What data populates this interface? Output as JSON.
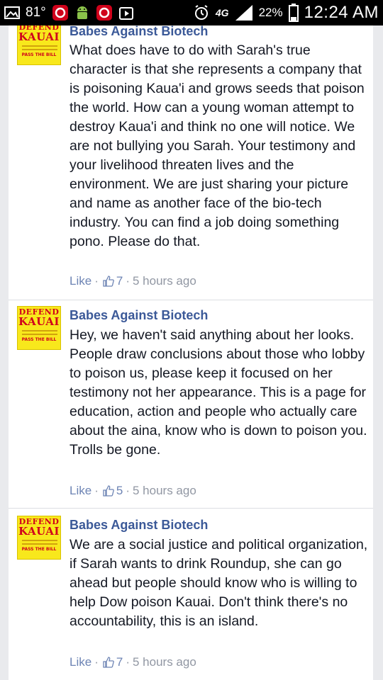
{
  "status_bar": {
    "temperature": "81°",
    "network": "4G",
    "battery": "22%",
    "time": "12:24 AM"
  },
  "avatar": {
    "top_text": "DEFEND",
    "main_text": "KAUAI",
    "bottom_text": "PASS THE BILL"
  },
  "comments": [
    {
      "author": "Babes Against Biotech",
      "text": "What does have to do with Sarah's true character is that she represents a company that is poisoning Kaua'i and grows seeds that poison the world. How can a young woman attempt to destroy Kaua'i and think no one will notice. We are not bullying you Sarah. Your testimony and your livelihood threaten lives and the environment. We are just sharing your picture and name as another face of the bio-tech industry. You can find a job doing something pono. Please do that.",
      "like_label": "Like",
      "likes": "7",
      "time": "5 hours ago"
    },
    {
      "author": "Babes Against Biotech",
      "text": "Hey, we haven't said anything about her looks. People draw conclusions about those who lobby to poison us, please keep it focused on her testimony not her appearance. This is a page for education, action and people who actually care about the aina, know who is down to poison you. Trolls be gone.",
      "like_label": "Like",
      "likes": "5",
      "time": "5 hours ago"
    },
    {
      "author": "Babes Against Biotech",
      "text": "We are a social justice and political organization, if Sarah wants to drink Roundup, she can go ahead but people should know who is willing to help Dow poison Kauai. Don't think there's no accountability, this is an island.",
      "like_label": "Like",
      "likes": "7",
      "time": "5 hours ago"
    }
  ]
}
